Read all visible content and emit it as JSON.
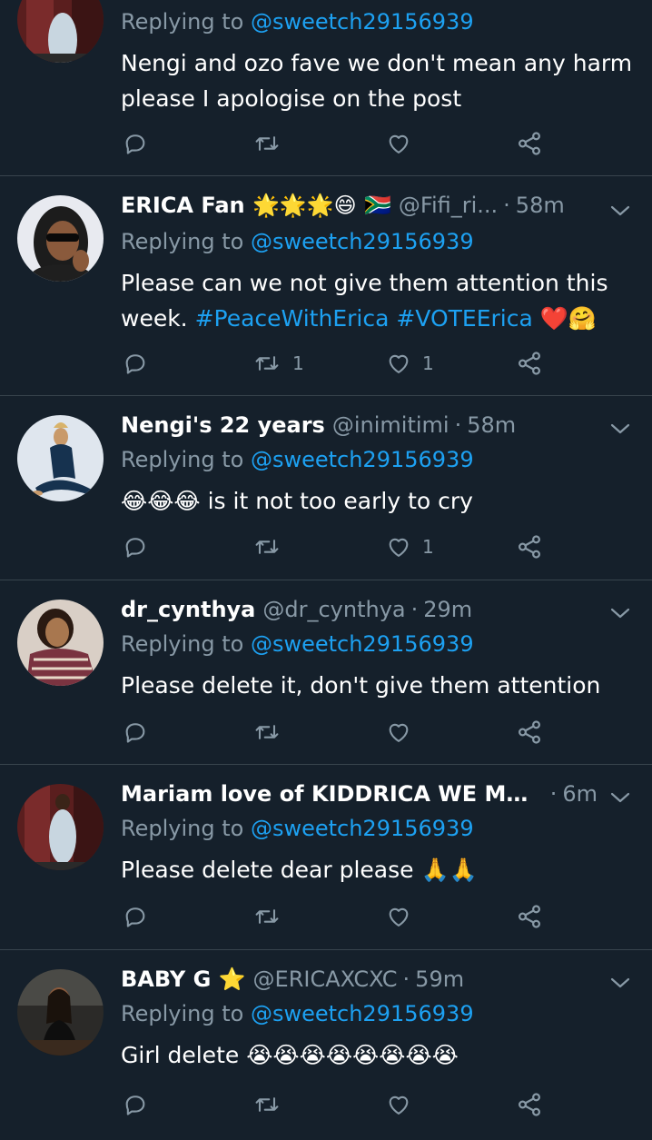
{
  "tweets": [
    {
      "display_name": "",
      "handle": "",
      "time": "",
      "replying_label": "Replying to",
      "replying_to": "@sweetch29156939",
      "text": "Nengi and ozo fave we don't mean any harm please I apologise on the post",
      "reply_count": "",
      "retweet_count": "",
      "like_count": ""
    },
    {
      "display_name": "ERICA Fan 🌟🌟🌟😄 🇿🇦",
      "handle": "@Fifi_ri...",
      "time": "58m",
      "replying_label": "Replying to",
      "replying_to": "@sweetch29156939",
      "text_before": "Please can we not give them attention this week. ",
      "hashtag_1": "#PeaceWithErica",
      "hashtag_2": "#VOTEErica",
      "text_after": " ❤️🤗",
      "reply_count": "",
      "retweet_count": "1",
      "like_count": "1"
    },
    {
      "display_name": "Nengi's 22 years",
      "handle": "@inimitimi",
      "time": "58m",
      "replying_label": "Replying to",
      "replying_to": "@sweetch29156939",
      "text": "😂😂😂 is it not too early to cry",
      "reply_count": "",
      "retweet_count": "",
      "like_count": "1"
    },
    {
      "display_name": "dr_cynthya",
      "handle": "@dr_cynthya",
      "time": "29m",
      "replying_label": "Replying to",
      "replying_to": "@sweetch29156939",
      "text": "Please delete it, don't give them attention",
      "reply_count": "",
      "retweet_count": "",
      "like_count": ""
    },
    {
      "display_name": "Mariam love of KIDDRICA WE MOVE ...",
      "handle": "",
      "time": "6m",
      "replying_label": "Replying to",
      "replying_to": "@sweetch29156939",
      "text": "Please delete dear please 🙏🙏",
      "reply_count": "",
      "retweet_count": "",
      "like_count": ""
    },
    {
      "display_name": "BABY G ⭐",
      "handle": "@ERICAXCXC",
      "time": "59m",
      "replying_label": "Replying to",
      "replying_to": "@sweetch29156939",
      "text": "Girl delete 😭😭😭😭😭😭😭😭",
      "reply_count": "",
      "retweet_count": "",
      "like_count": ""
    }
  ],
  "separator_dot": "·",
  "icons": {
    "reply": "reply-icon",
    "retweet": "retweet-icon",
    "like": "heart-icon",
    "share": "share-icon",
    "more": "chevron-down-icon"
  },
  "colors": {
    "background": "#15202b",
    "divider": "#38444d",
    "secondary_text": "#8899a6",
    "link": "#1da1f2"
  }
}
